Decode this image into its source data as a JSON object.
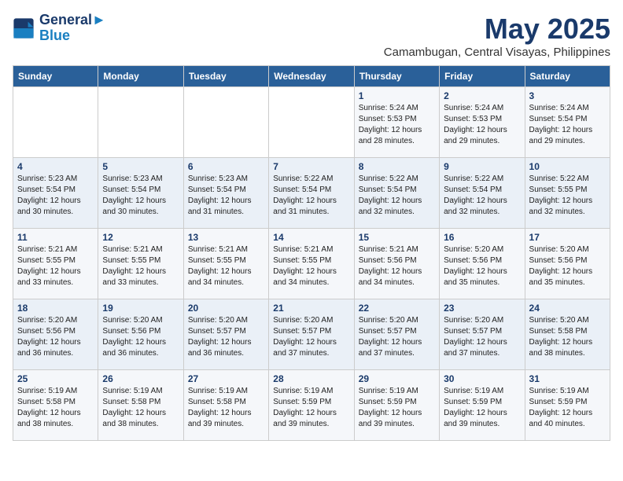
{
  "logo": {
    "line1": "General",
    "line2": "Blue"
  },
  "title": "May 2025",
  "location": "Camambugan, Central Visayas, Philippines",
  "weekdays": [
    "Sunday",
    "Monday",
    "Tuesday",
    "Wednesday",
    "Thursday",
    "Friday",
    "Saturday"
  ],
  "weeks": [
    [
      {
        "day": "",
        "sunrise": "",
        "sunset": "",
        "daylight": ""
      },
      {
        "day": "",
        "sunrise": "",
        "sunset": "",
        "daylight": ""
      },
      {
        "day": "",
        "sunrise": "",
        "sunset": "",
        "daylight": ""
      },
      {
        "day": "",
        "sunrise": "",
        "sunset": "",
        "daylight": ""
      },
      {
        "day": "1",
        "sunrise": "5:24 AM",
        "sunset": "5:53 PM",
        "daylight": "12 hours and 28 minutes."
      },
      {
        "day": "2",
        "sunrise": "5:24 AM",
        "sunset": "5:53 PM",
        "daylight": "12 hours and 29 minutes."
      },
      {
        "day": "3",
        "sunrise": "5:24 AM",
        "sunset": "5:54 PM",
        "daylight": "12 hours and 29 minutes."
      }
    ],
    [
      {
        "day": "4",
        "sunrise": "5:23 AM",
        "sunset": "5:54 PM",
        "daylight": "12 hours and 30 minutes."
      },
      {
        "day": "5",
        "sunrise": "5:23 AM",
        "sunset": "5:54 PM",
        "daylight": "12 hours and 30 minutes."
      },
      {
        "day": "6",
        "sunrise": "5:23 AM",
        "sunset": "5:54 PM",
        "daylight": "12 hours and 31 minutes."
      },
      {
        "day": "7",
        "sunrise": "5:22 AM",
        "sunset": "5:54 PM",
        "daylight": "12 hours and 31 minutes."
      },
      {
        "day": "8",
        "sunrise": "5:22 AM",
        "sunset": "5:54 PM",
        "daylight": "12 hours and 32 minutes."
      },
      {
        "day": "9",
        "sunrise": "5:22 AM",
        "sunset": "5:54 PM",
        "daylight": "12 hours and 32 minutes."
      },
      {
        "day": "10",
        "sunrise": "5:22 AM",
        "sunset": "5:55 PM",
        "daylight": "12 hours and 32 minutes."
      }
    ],
    [
      {
        "day": "11",
        "sunrise": "5:21 AM",
        "sunset": "5:55 PM",
        "daylight": "12 hours and 33 minutes."
      },
      {
        "day": "12",
        "sunrise": "5:21 AM",
        "sunset": "5:55 PM",
        "daylight": "12 hours and 33 minutes."
      },
      {
        "day": "13",
        "sunrise": "5:21 AM",
        "sunset": "5:55 PM",
        "daylight": "12 hours and 34 minutes."
      },
      {
        "day": "14",
        "sunrise": "5:21 AM",
        "sunset": "5:55 PM",
        "daylight": "12 hours and 34 minutes."
      },
      {
        "day": "15",
        "sunrise": "5:21 AM",
        "sunset": "5:56 PM",
        "daylight": "12 hours and 34 minutes."
      },
      {
        "day": "16",
        "sunrise": "5:20 AM",
        "sunset": "5:56 PM",
        "daylight": "12 hours and 35 minutes."
      },
      {
        "day": "17",
        "sunrise": "5:20 AM",
        "sunset": "5:56 PM",
        "daylight": "12 hours and 35 minutes."
      }
    ],
    [
      {
        "day": "18",
        "sunrise": "5:20 AM",
        "sunset": "5:56 PM",
        "daylight": "12 hours and 36 minutes."
      },
      {
        "day": "19",
        "sunrise": "5:20 AM",
        "sunset": "5:56 PM",
        "daylight": "12 hours and 36 minutes."
      },
      {
        "day": "20",
        "sunrise": "5:20 AM",
        "sunset": "5:57 PM",
        "daylight": "12 hours and 36 minutes."
      },
      {
        "day": "21",
        "sunrise": "5:20 AM",
        "sunset": "5:57 PM",
        "daylight": "12 hours and 37 minutes."
      },
      {
        "day": "22",
        "sunrise": "5:20 AM",
        "sunset": "5:57 PM",
        "daylight": "12 hours and 37 minutes."
      },
      {
        "day": "23",
        "sunrise": "5:20 AM",
        "sunset": "5:57 PM",
        "daylight": "12 hours and 37 minutes."
      },
      {
        "day": "24",
        "sunrise": "5:20 AM",
        "sunset": "5:58 PM",
        "daylight": "12 hours and 38 minutes."
      }
    ],
    [
      {
        "day": "25",
        "sunrise": "5:19 AM",
        "sunset": "5:58 PM",
        "daylight": "12 hours and 38 minutes."
      },
      {
        "day": "26",
        "sunrise": "5:19 AM",
        "sunset": "5:58 PM",
        "daylight": "12 hours and 38 minutes."
      },
      {
        "day": "27",
        "sunrise": "5:19 AM",
        "sunset": "5:58 PM",
        "daylight": "12 hours and 39 minutes."
      },
      {
        "day": "28",
        "sunrise": "5:19 AM",
        "sunset": "5:59 PM",
        "daylight": "12 hours and 39 minutes."
      },
      {
        "day": "29",
        "sunrise": "5:19 AM",
        "sunset": "5:59 PM",
        "daylight": "12 hours and 39 minutes."
      },
      {
        "day": "30",
        "sunrise": "5:19 AM",
        "sunset": "5:59 PM",
        "daylight": "12 hours and 39 minutes."
      },
      {
        "day": "31",
        "sunrise": "5:19 AM",
        "sunset": "5:59 PM",
        "daylight": "12 hours and 40 minutes."
      }
    ]
  ]
}
